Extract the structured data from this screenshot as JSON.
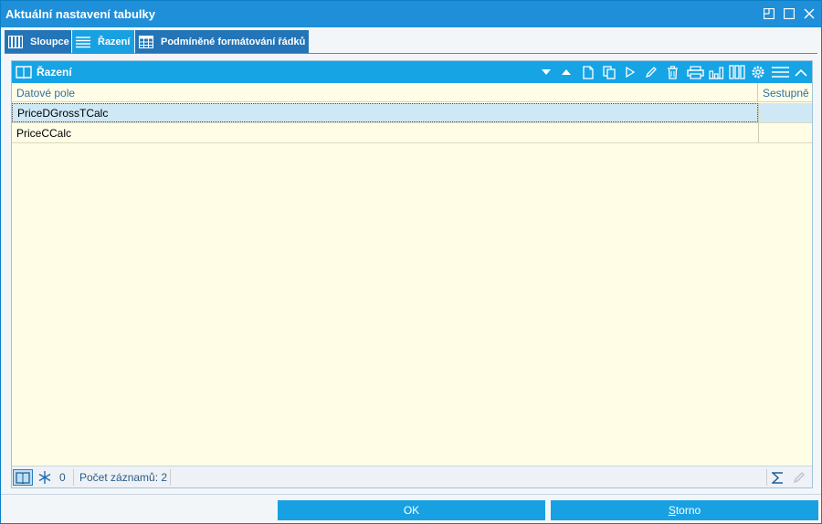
{
  "window": {
    "title": "Aktuální nastavení tabulky",
    "icons": [
      "restore-icon",
      "maximize-icon",
      "close-icon"
    ]
  },
  "tabs": [
    {
      "label": "Sloupce",
      "icon": "columns-icon"
    },
    {
      "label": "Řazení",
      "icon": "lines-icon",
      "active": true
    },
    {
      "label": "Podmíněné formátování řádků",
      "icon": "table-icon"
    }
  ],
  "panel": {
    "title": "Řazení",
    "icon": "book-icon",
    "toolbar_icons": [
      "sort-down-icon",
      "sort-up-icon",
      "new-document-icon",
      "copy-icon",
      "play-icon",
      "edit-icon",
      "delete-icon",
      "print-icon",
      "chart-icon",
      "columns-icon",
      "settings-icon",
      "menu-icon",
      "collapse-icon"
    ]
  },
  "grid": {
    "columns": [
      "Datové pole",
      "Sestupně"
    ],
    "rows": [
      {
        "field": "PriceDGrossTCalc",
        "desc": "",
        "selected": true
      },
      {
        "field": "PriceCCalc",
        "desc": "",
        "selected": false
      }
    ]
  },
  "status": {
    "freeze_count": "0",
    "record_count": "Počet záznamů: 2"
  },
  "buttons": {
    "ok": "OK",
    "storno_first": "S",
    "storno_rest": "torno"
  },
  "colors": {
    "titlebar": "#1e8fd8",
    "accent": "#18a1e2",
    "tab_inactive": "#2375b8",
    "grid_bg": "#fffde6",
    "selected_row": "#cfe8f5"
  }
}
